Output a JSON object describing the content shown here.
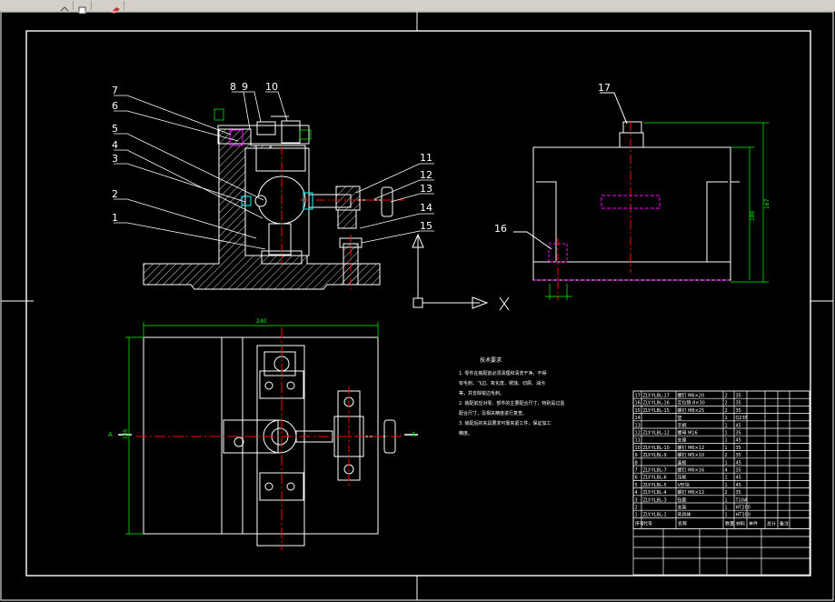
{
  "toolbar": {
    "buttons": [
      {
        "icon": "undo-icon"
      },
      {
        "icon": "copy-icon"
      },
      {
        "icon": "tool-icon"
      }
    ]
  },
  "balloons": [
    "1",
    "2",
    "3",
    "4",
    "5",
    "6",
    "7",
    "8",
    "9",
    "10",
    "11",
    "12",
    "13",
    "14",
    "15",
    "16",
    "17"
  ],
  "ucs": {
    "x_label": "X"
  },
  "dimensions": {
    "plan_width": "240",
    "plan_height": "185",
    "side_a": "180",
    "side_b": "167"
  },
  "section_marks": {
    "left": "A",
    "right": "A"
  },
  "notes": {
    "title": "技术要求",
    "lines": [
      "1. 零件在装配前必须清理和清洗干净，不得",
      "有毛刺、飞边、氧化皮、锈蚀、切屑、油污",
      "等，并去除锐边毛刺。",
      "2. 装配前应对零、部件的主要配合尺寸，特别是过盈",
      "配合尺寸，及相关精度进行复查。",
      "3. 装配后的夹具要求可靠夹紧工件，保证加工",
      "精度。"
    ]
  },
  "title_block": {
    "header": [
      "序号",
      "代号",
      "名称",
      "数量",
      "材料",
      "单件",
      "总计",
      "备注"
    ],
    "rows": [
      {
        "no": "17",
        "code": "ZLY-YLBL-17",
        "name": "螺钉 M6×20",
        "qty": "2",
        "mat": "35"
      },
      {
        "no": "16",
        "code": "ZLY-YLBL-16",
        "name": "定位销 8×30",
        "qty": "2",
        "mat": "35"
      },
      {
        "no": "15",
        "code": "ZLY-YLBL-15",
        "name": "螺钉 M8×25",
        "qty": "2",
        "mat": "35"
      },
      {
        "no": "14",
        "code": "",
        "name": "垫",
        "qty": "1",
        "mat": "Q235"
      },
      {
        "no": "13",
        "code": "",
        "name": "手柄",
        "qty": "1",
        "mat": "45"
      },
      {
        "no": "12",
        "code": "ZLY-YLBL-12",
        "name": "螺母 M16",
        "qty": "1",
        "mat": "35"
      },
      {
        "no": "11",
        "code": "",
        "name": "支座",
        "qty": "1",
        "mat": "45"
      },
      {
        "no": "10",
        "code": "ZLY-YLBL-10",
        "name": "螺钉 M6×12",
        "qty": "1",
        "mat": "35"
      },
      {
        "no": "9",
        "code": "ZLY-YLBL-9",
        "name": "螺钉 M5×10",
        "qty": "2",
        "mat": "35"
      },
      {
        "no": "8",
        "code": "",
        "name": "盖板",
        "qty": "1",
        "mat": "45"
      },
      {
        "no": "7",
        "code": "ZLY-YLBL-7",
        "name": "螺钉 M6×16",
        "qty": "4",
        "mat": "35"
      },
      {
        "no": "6",
        "code": "ZLY-YLBL-6",
        "name": "压板",
        "qty": "1",
        "mat": "45"
      },
      {
        "no": "5",
        "code": "ZLY-YLBL-5",
        "name": "V形块",
        "qty": "1",
        "mat": "45"
      },
      {
        "no": "4",
        "code": "ZLY-YLBL-4",
        "name": "螺钉 M6×12",
        "qty": "2",
        "mat": "35"
      },
      {
        "no": "3",
        "code": "ZLY-YLBL-3",
        "name": "钻套",
        "qty": "1",
        "mat": "T10A"
      },
      {
        "no": "2",
        "code": "",
        "name": "支架",
        "qty": "1",
        "mat": "HT200"
      },
      {
        "no": "1",
        "code": "ZLY-YLBL-1",
        "name": "夹具体",
        "qty": "1",
        "mat": "HT200"
      }
    ]
  },
  "colors": {
    "background": "#000000",
    "frame": "#ffffff",
    "dimension": "#00ff00",
    "centerline": "#ff0000",
    "hidden": "#ff00ff",
    "accent": "#00ffff"
  }
}
